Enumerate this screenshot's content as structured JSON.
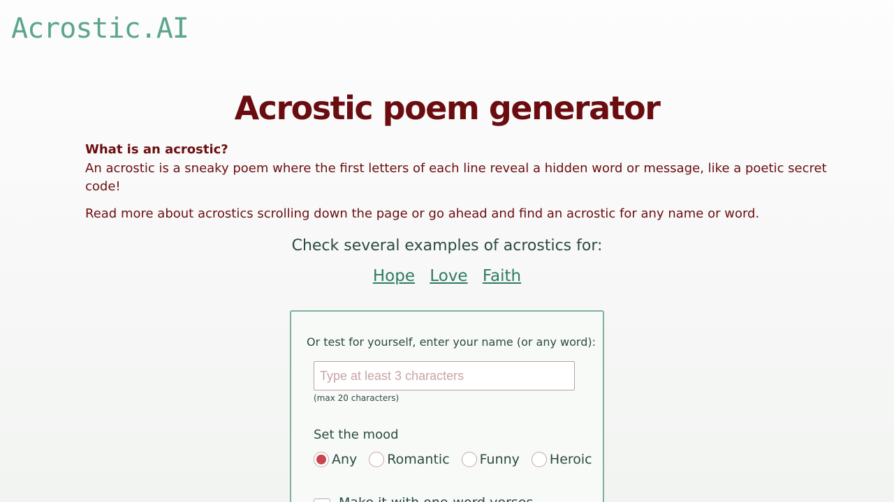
{
  "header": {
    "logo_text": "Acrostic.AI"
  },
  "main": {
    "title": "Acrostic poem generator",
    "intro_heading": "What is an acrostic?",
    "intro_paragraph_1": "An acrostic is a sneaky poem where the first letters of each line reveal a hidden word or message, like a poetic secret code!",
    "intro_paragraph_2": "Read more about acrostics scrolling down the page or go ahead and find an acrostic for any name or word."
  },
  "examples": {
    "title": "Check several examples of acrostics for:",
    "links": [
      "Hope",
      "Love",
      "Faith"
    ]
  },
  "form": {
    "prompt": "Or test for yourself, enter your name (or any word):",
    "input_value": "",
    "input_placeholder": "Type at least 3 characters",
    "input_hint": "(max 20 characters)",
    "mood_label": "Set the mood",
    "moods": [
      {
        "label": "Any",
        "checked": true
      },
      {
        "label": "Romantic",
        "checked": false
      },
      {
        "label": "Funny",
        "checked": false
      },
      {
        "label": "Heroic",
        "checked": false
      }
    ],
    "one_word_label": "Make it with one-word verses",
    "one_word_checked": false
  },
  "colors": {
    "brand": "#5ba58c",
    "title": "#6b0d10",
    "link": "#2e7a62",
    "radio_selected": "#c9454c",
    "box_border": "#7fb0a0"
  }
}
